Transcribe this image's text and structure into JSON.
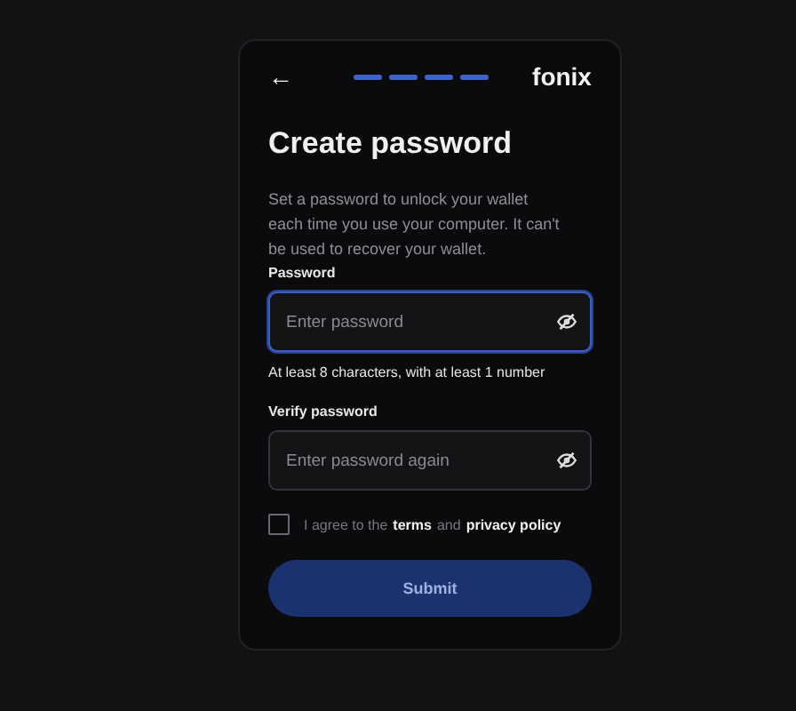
{
  "header": {
    "back": "←",
    "steps": [
      {
        "done": true
      },
      {
        "done": true
      },
      {
        "done": true
      },
      {
        "done": true
      }
    ],
    "logo": "fonix"
  },
  "title": "Create password",
  "description": "Set a password to unlock your wallet each time you use your computer. It can't be used to recover your wallet.",
  "fields": [
    {
      "label": "Password",
      "placeholder": "Enter password",
      "focused": true,
      "hint": "At least 8 characters, with at least 1 number"
    },
    {
      "label": "Verify password",
      "placeholder": "Enter password again",
      "focused": false
    }
  ],
  "agreement": {
    "checked": false,
    "prefix": "I agree to the",
    "terms": "terms",
    "joiner": "and",
    "privacy": "privacy policy"
  },
  "submit": {
    "label": "Submit",
    "disabled": true
  }
}
